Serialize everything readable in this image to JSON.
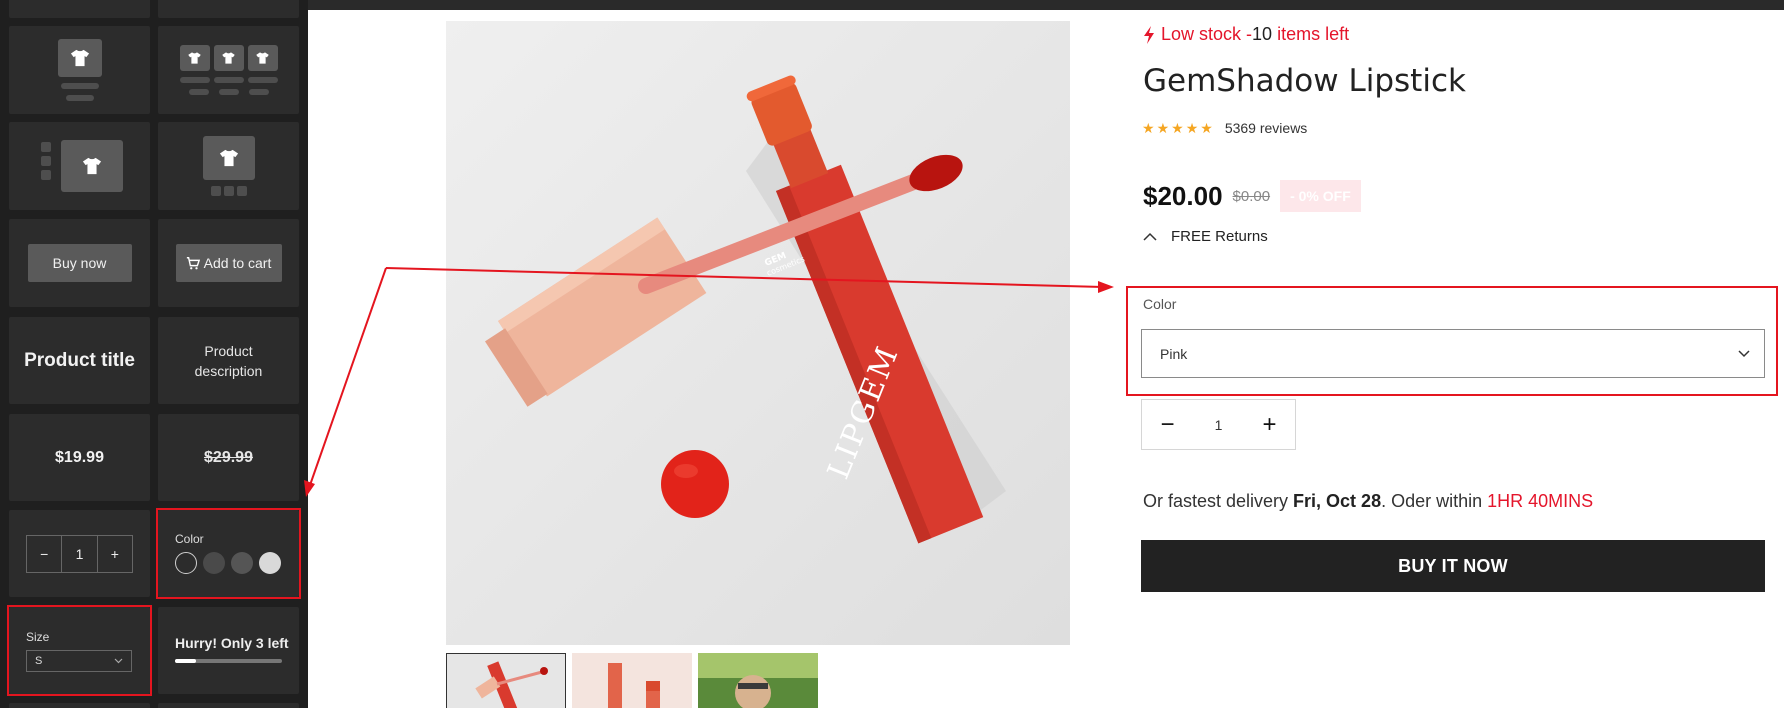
{
  "left_panel": {
    "buy_now_label": "Buy now",
    "add_to_cart_label": "Add to cart",
    "product_title_label": "Product title",
    "product_description_label": "Product description",
    "price": "$19.99",
    "compare_price": "$29.99",
    "quantity": "1",
    "color_label": "Color",
    "swatches": [
      "#2c2c2c",
      "#4a4a4a",
      "#555555",
      "#d9d9d9"
    ],
    "size_label": "Size",
    "size_value": "S",
    "hurry_label": "Hurry! Only 3 left",
    "hurry_progress_fraction": 0.2
  },
  "product": {
    "stock_text": "Low stock - ",
    "stock_count": "10",
    "stock_suffix": " items left",
    "title": "GemShadow Lipstick",
    "rating": 5,
    "reviews": "5369 reviews",
    "price": "$20.00",
    "compare_price": "$0.00",
    "discount_badge": "- 0% OFF",
    "returns_label": "FREE Returns",
    "color_label": "Color",
    "color_value": "Pink",
    "quantity": "1",
    "delivery_prefix": "Or fastest delivery ",
    "delivery_date": "Fri, Oct 28",
    "delivery_mid": ". Oder within ",
    "delivery_countdown": "1HR 40MINS",
    "buy_button_label": "BUY IT NOW",
    "image_brand": "LIPGEM",
    "image_logo": "GEM",
    "image_logo_sub": "cosmetics"
  },
  "colors": {
    "accent_red": "#e4152b",
    "annotation_red": "#e4151f",
    "star": "#f5a623",
    "dark_button": "#222222",
    "panel_bg": "#1f1f1f"
  }
}
